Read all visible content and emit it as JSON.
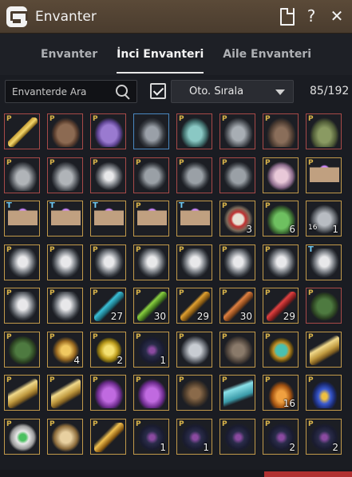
{
  "window": {
    "title": "Envanter"
  },
  "title_actions": [
    {
      "name": "document-icon",
      "glyph": ""
    },
    {
      "name": "help-icon",
      "glyph": "?"
    },
    {
      "name": "close-icon",
      "glyph": "✕"
    }
  ],
  "tabs": [
    {
      "label": "Envanter",
      "active": false
    },
    {
      "label": "İnci Envanteri",
      "active": true
    },
    {
      "label": "Aile Envanteri",
      "active": false
    }
  ],
  "toolbar": {
    "search_placeholder": "Envanterde Ara",
    "sort_label": "Oto. Sırala",
    "sort_checked": true,
    "count": "85/192"
  },
  "slots": [
    {
      "art": "sword",
      "tag": "P",
      "border": "red"
    },
    {
      "art": "armor-brown",
      "tag": "P",
      "border": "red"
    },
    {
      "art": "armor-purple",
      "tag": "P",
      "border": "red"
    },
    {
      "art": "armor-steel",
      "tag": "",
      "border": "blue"
    },
    {
      "art": "gauntlet-teal",
      "tag": "P",
      "border": "red"
    },
    {
      "art": "gauntlet-grey",
      "tag": "P",
      "border": "red"
    },
    {
      "art": "boots-brown",
      "tag": "P",
      "border": "red"
    },
    {
      "art": "boots-green",
      "tag": "P",
      "border": "red"
    },
    {
      "art": "shoulder",
      "tag": "P",
      "border": "red"
    },
    {
      "art": "shoulder",
      "tag": "P",
      "border": "red"
    },
    {
      "art": "crest",
      "tag": "P",
      "border": "red"
    },
    {
      "art": "helmet",
      "tag": "P",
      "border": "red"
    },
    {
      "art": "helmet",
      "tag": "P",
      "border": "red"
    },
    {
      "art": "helmet",
      "tag": "P",
      "border": "red"
    },
    {
      "art": "scroll-pink",
      "tag": "P",
      "border": "gold"
    },
    {
      "art": "book-purple",
      "tag": "P",
      "border": "gold"
    },
    {
      "art": "book-purple",
      "tag": "T",
      "border": "gold"
    },
    {
      "art": "book-purple",
      "tag": "T",
      "border": "gold"
    },
    {
      "art": "book-purple",
      "tag": "T",
      "border": "gold"
    },
    {
      "art": "book-purple",
      "tag": "P",
      "border": "gold"
    },
    {
      "art": "book-purple",
      "tag": "T",
      "border": "gold"
    },
    {
      "art": "banner-red",
      "tag": "P",
      "border": "gold",
      "count": "3"
    },
    {
      "art": "turtle",
      "tag": "P",
      "border": "gold",
      "count": "6"
    },
    {
      "art": "net",
      "tag": "",
      "border": "gold",
      "count": "1",
      "small": "16"
    },
    {
      "art": "tree",
      "tag": "P",
      "border": "gold"
    },
    {
      "art": "tree",
      "tag": "P",
      "border": "gold"
    },
    {
      "art": "tree",
      "tag": "P",
      "border": "gold"
    },
    {
      "art": "tree",
      "tag": "P",
      "border": "gold"
    },
    {
      "art": "tree",
      "tag": "P",
      "border": "gold"
    },
    {
      "art": "tree",
      "tag": "P",
      "border": "gold"
    },
    {
      "art": "tree",
      "tag": "P",
      "border": "gold"
    },
    {
      "art": "tree",
      "tag": "T",
      "border": "gold"
    },
    {
      "art": "tree",
      "tag": "P",
      "border": "gold"
    },
    {
      "art": "tree",
      "tag": "P",
      "border": "gold"
    },
    {
      "art": "tool-cyan",
      "tag": "P",
      "border": "gold",
      "count": "27"
    },
    {
      "art": "tool-green",
      "tag": "P",
      "border": "gold",
      "count": "30"
    },
    {
      "art": "tool-gold",
      "tag": "P",
      "border": "gold",
      "count": "29"
    },
    {
      "art": "tool-orange",
      "tag": "P",
      "border": "gold",
      "count": "30"
    },
    {
      "art": "tool-red",
      "tag": "P",
      "border": "gold",
      "count": "29"
    },
    {
      "art": "tome-green",
      "tag": "P",
      "border": "red"
    },
    {
      "art": "tome-green",
      "tag": "P",
      "border": "gold"
    },
    {
      "art": "trophy",
      "tag": "P",
      "border": "gold",
      "count": "4"
    },
    {
      "art": "butterfly",
      "tag": "P",
      "border": "gold",
      "count": "2"
    },
    {
      "art": "map-dark",
      "tag": "P",
      "border": "gold",
      "count": "1"
    },
    {
      "art": "furniture",
      "tag": "P",
      "border": "gold"
    },
    {
      "art": "cart",
      "tag": "P",
      "border": "gold"
    },
    {
      "art": "medal",
      "tag": "P",
      "border": "gold"
    },
    {
      "art": "horn",
      "tag": "P",
      "border": "gold"
    },
    {
      "art": "horn",
      "tag": "P",
      "border": "gold"
    },
    {
      "art": "horn",
      "tag": "P",
      "border": "gold"
    },
    {
      "art": "chest-purple",
      "tag": "P",
      "border": "gold"
    },
    {
      "art": "chest-purple",
      "tag": "P",
      "border": "gold"
    },
    {
      "art": "chair",
      "tag": "P",
      "border": "gold"
    },
    {
      "art": "ticket",
      "tag": "P",
      "border": "gold"
    },
    {
      "art": "flask-orange",
      "tag": "P",
      "border": "gold",
      "count": "16"
    },
    {
      "art": "flask-blue",
      "tag": "P",
      "border": "gold"
    },
    {
      "art": "paw",
      "tag": "P",
      "border": "gold"
    },
    {
      "art": "shell",
      "tag": "P",
      "border": "gold"
    },
    {
      "art": "dagger",
      "tag": "P",
      "border": "gold"
    },
    {
      "art": "map-dark",
      "tag": "P",
      "border": "gold",
      "count": "1"
    },
    {
      "art": "map-dark",
      "tag": "P",
      "border": "gold",
      "count": "1"
    },
    {
      "art": "map-dark",
      "tag": "P",
      "border": "gold"
    },
    {
      "art": "map-dark",
      "tag": "P",
      "border": "gold",
      "count": "2"
    },
    {
      "art": "map-dark",
      "tag": "P",
      "border": "gold",
      "count": "2"
    }
  ],
  "colors": {
    "titlebar": "#5b4a38",
    "panel": "#1a1c22",
    "slot_gold_border": "#c29a4a",
    "slot_red_border": "#a84a48",
    "premium_tag": "#d9b44a"
  }
}
